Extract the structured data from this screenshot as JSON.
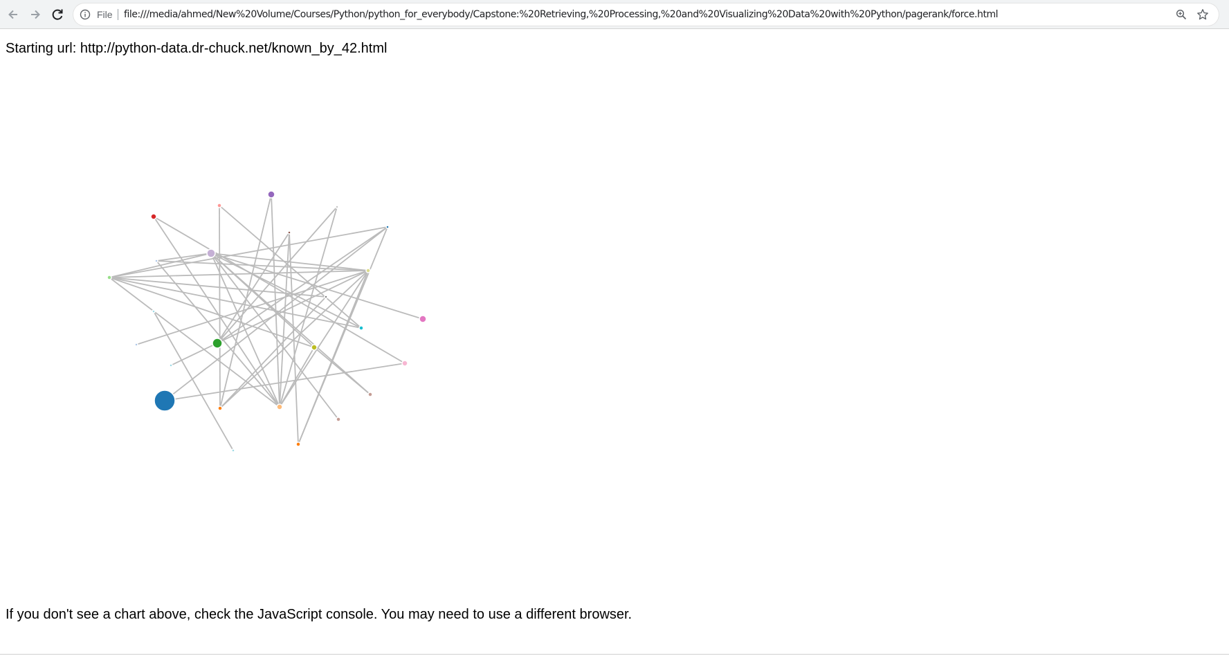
{
  "browser": {
    "scheme_label": "File",
    "url": "file:///media/ahmed/New%20Volume/Courses/Python/python_for_everybody/Capstone:%20Retrieving,%20Processing,%20and%20Visualizing%20Data%20with%20Python/pagerank/force.html",
    "back_icon": "arrow-left-icon",
    "forward_icon": "arrow-right-icon",
    "reload_icon": "reload-icon",
    "info_icon": "info-icon",
    "zoom_icon": "zoom-icon",
    "bookmark_icon": "star-icon"
  },
  "page": {
    "start_line": "Starting url: http://python-data.dr-chuck.net/known_by_42.html",
    "footer_note": "If you don't see a chart above, check the JavaScript console. You may need to use a different browser."
  },
  "graph": {
    "link_color": "#bbbbbb",
    "nodes": [
      {
        "id": "purple",
        "color": "#9467bd",
        "rank": 5
      },
      {
        "id": "salmon",
        "color": "#ff9896",
        "rank": 3
      },
      {
        "id": "grey",
        "color": "#c7c7c7",
        "rank": 2
      },
      {
        "id": "red",
        "color": "#d62728",
        "rank": 4
      },
      {
        "id": "darkblue",
        "color": "#1f77b4",
        "rank": 2
      },
      {
        "id": "brown",
        "color": "#8c564b",
        "rank": 2
      },
      {
        "id": "lavender",
        "color": "#c5b0d5",
        "rank": 6
      },
      {
        "id": "lightblue",
        "color": "#aec7e8",
        "rank": 2
      },
      {
        "id": "khaki",
        "color": "#dbdb8d",
        "rank": 3
      },
      {
        "id": "lightgreen",
        "color": "#98df8a",
        "rank": 3
      },
      {
        "id": "darkgrey",
        "color": "#7f7f7f",
        "rank": 2
      },
      {
        "id": "skyblue",
        "color": "#9edae5",
        "rank": 2
      },
      {
        "id": "teal",
        "color": "#17becf",
        "rank": 3
      },
      {
        "id": "pink",
        "color": "#e377c2",
        "rank": 5
      },
      {
        "id": "steelblue",
        "color": "#aec7e8",
        "rank": 2
      },
      {
        "id": "green",
        "color": "#2ca02c",
        "rank": 7
      },
      {
        "id": "olive",
        "color": "#bcbd22",
        "rank": 4
      },
      {
        "id": "cyanlight",
        "color": "#9edae5",
        "rank": 2
      },
      {
        "id": "lightpink",
        "color": "#f7b6d2",
        "rank": 4
      },
      {
        "id": "bigblue",
        "color": "#1f77b4",
        "rank": 15
      },
      {
        "id": "orange1",
        "color": "#ff7f0e",
        "rank": 3
      },
      {
        "id": "peach",
        "color": "#ffbb78",
        "rank": 4
      },
      {
        "id": "rosybrown",
        "color": "#c49c94",
        "rank": 3
      },
      {
        "id": "tan",
        "color": "#c49c94",
        "rank": 3
      },
      {
        "id": "orange2",
        "color": "#ff7f0e",
        "rank": 3
      },
      {
        "id": "paleblue",
        "color": "#9edae5",
        "rank": 2
      }
    ],
    "links": [
      [
        "red",
        "lightpink"
      ],
      [
        "red",
        "peach"
      ],
      [
        "salmon",
        "teal"
      ],
      [
        "salmon",
        "orange1"
      ],
      [
        "purple",
        "orange1"
      ],
      [
        "purple",
        "peach"
      ],
      [
        "grey",
        "green"
      ],
      [
        "grey",
        "peach"
      ],
      [
        "darkblue",
        "green"
      ],
      [
        "darkblue",
        "bigblue"
      ],
      [
        "darkblue",
        "lightgreen"
      ],
      [
        "darkblue",
        "orange2"
      ],
      [
        "brown",
        "green"
      ],
      [
        "brown",
        "peach"
      ],
      [
        "brown",
        "orange2"
      ],
      [
        "lavender",
        "lightgreen"
      ],
      [
        "lavender",
        "khaki"
      ],
      [
        "lavender",
        "pink"
      ],
      [
        "lavender",
        "teal"
      ],
      [
        "lavender",
        "rosybrown"
      ],
      [
        "lavender",
        "tan"
      ],
      [
        "lavender",
        "peach"
      ],
      [
        "lavender",
        "olive"
      ],
      [
        "lightblue",
        "khaki"
      ],
      [
        "lightblue",
        "peach"
      ],
      [
        "lightblue",
        "lavender"
      ],
      [
        "lightgreen",
        "khaki"
      ],
      [
        "lightgreen",
        "olive"
      ],
      [
        "lightgreen",
        "teal"
      ],
      [
        "lightgreen",
        "darkgrey"
      ],
      [
        "lightgreen",
        "peach"
      ],
      [
        "khaki",
        "steelblue"
      ],
      [
        "khaki",
        "cyanlight"
      ],
      [
        "khaki",
        "peach"
      ],
      [
        "khaki",
        "orange1"
      ],
      [
        "khaki",
        "orange2"
      ],
      [
        "skyblue",
        "paleblue"
      ],
      [
        "olive",
        "peach"
      ],
      [
        "olive",
        "rosybrown"
      ],
      [
        "bigblue",
        "lightpink"
      ],
      [
        "darkgrey",
        "orange1"
      ]
    ]
  }
}
